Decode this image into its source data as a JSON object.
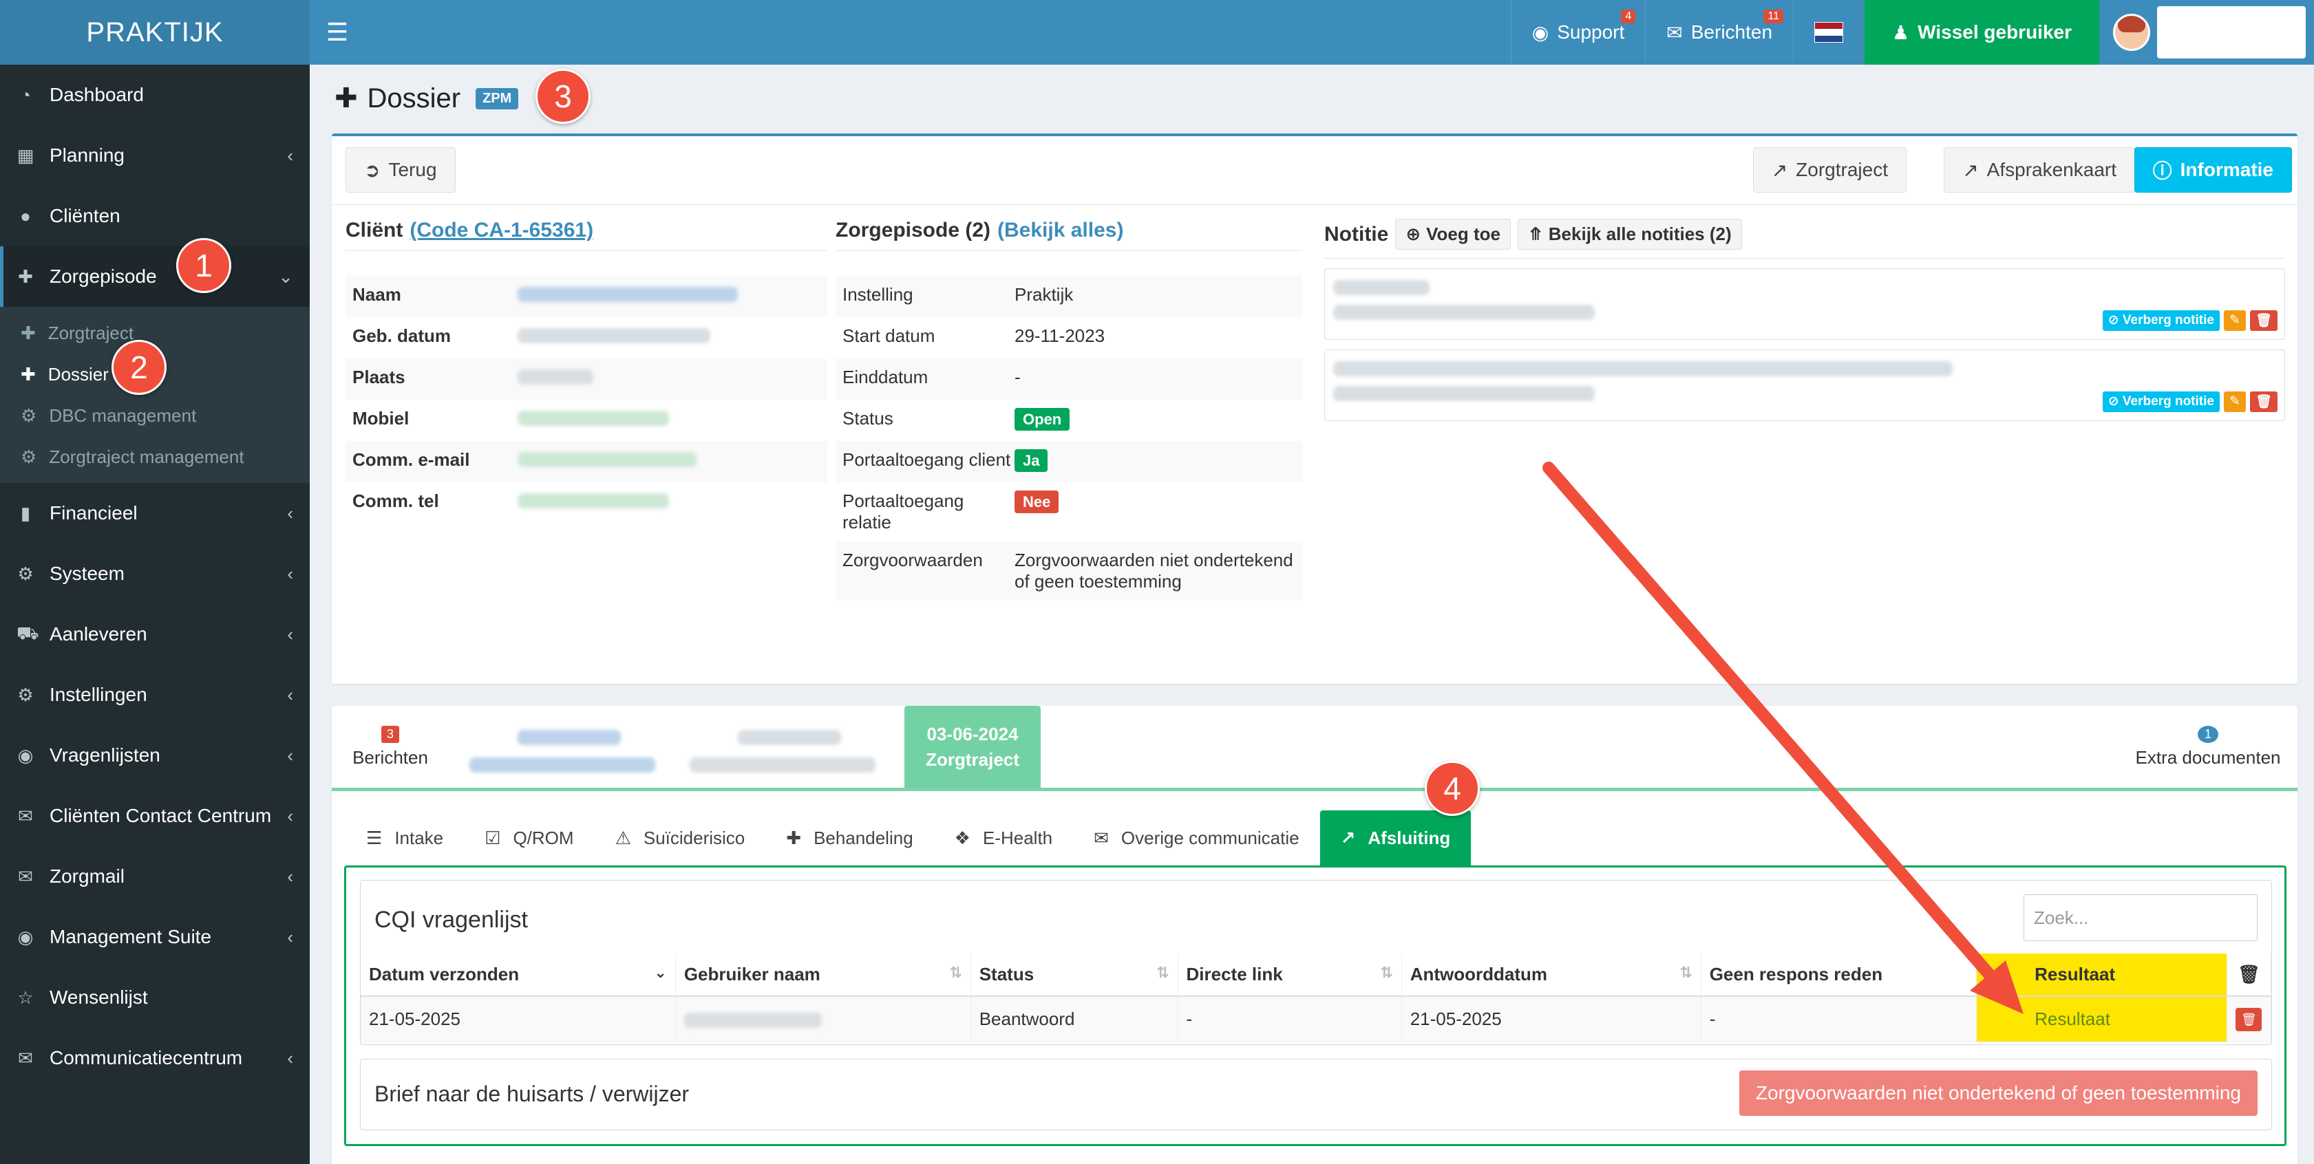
{
  "app": {
    "brand": "PRAKTIJK"
  },
  "topbar": {
    "support_label": "Support",
    "support_count": "4",
    "berichten_label": "Berichten",
    "berichten_count": "11",
    "wissel_label": "Wissel gebruiker"
  },
  "sidebar": {
    "items": [
      {
        "label": "Dashboard"
      },
      {
        "label": "Planning"
      },
      {
        "label": "Cliënten"
      },
      {
        "label": "Zorgepisode"
      },
      {
        "label": "Financieel"
      },
      {
        "label": "Systeem"
      },
      {
        "label": "Aanleveren"
      },
      {
        "label": "Instellingen"
      },
      {
        "label": "Vragenlijsten"
      },
      {
        "label": "Cliënten Contact Centrum"
      },
      {
        "label": "Zorgmail"
      },
      {
        "label": "Management Suite"
      },
      {
        "label": "Wensenlijst"
      },
      {
        "label": "Communicatiecentrum"
      }
    ],
    "sub_items": [
      {
        "label": "Zorgtraject"
      },
      {
        "label": "Dossier"
      },
      {
        "label": "DBC management"
      },
      {
        "label": "Zorgtraject management"
      }
    ]
  },
  "steps": [
    "1",
    "2",
    "3",
    "4"
  ],
  "page": {
    "title": "Dossier",
    "badge": "ZPM"
  },
  "toolbar": {
    "back_label": "Terug",
    "zorgtraject_label": "Zorgtraject",
    "afsprakenkaart_label": "Afsprakenkaart",
    "informatie_label": "Informatie"
  },
  "client": {
    "heading": "Cliënt",
    "code_link": "(Code CA-1-65361)",
    "fields": [
      "Naam",
      "Geb. datum",
      "Plaats",
      "Mobiel",
      "Comm. e-mail",
      "Comm. tel"
    ]
  },
  "episode": {
    "heading": "Zorgepisode (2)",
    "view_all": "(Bekijk alles)",
    "rows": [
      {
        "k": "Instelling",
        "v": "Praktijk"
      },
      {
        "k": "Start datum",
        "v": "29-11-2023"
      },
      {
        "k": "Einddatum",
        "v": "-"
      },
      {
        "k": "Status",
        "badge": "Open"
      },
      {
        "k": "Portaaltoegang client",
        "badge": "Ja"
      },
      {
        "k": "Portaaltoegang relatie",
        "badge": "Nee"
      },
      {
        "k": "Zorgvoorwaarden",
        "v": "Zorgvoorwaarden niet ondertekend of geen toestemming"
      }
    ]
  },
  "notes": {
    "heading": "Notitie",
    "add_label": "Voeg toe",
    "view_all_label": "Bekijk alle notities (2)",
    "hide_label": "Verberg notitie"
  },
  "timeline": {
    "berichten_count": "3",
    "berichten_label": "Berichten",
    "active_date": "03-06-2024",
    "active_label": "Zorgtraject",
    "extra_count": "1",
    "extra_label": "Extra documenten"
  },
  "tabs": [
    {
      "label": "Intake"
    },
    {
      "label": "Q/ROM"
    },
    {
      "label": "Suïciderisico"
    },
    {
      "label": "Behandeling"
    },
    {
      "label": "E-Health"
    },
    {
      "label": "Overige communicatie"
    },
    {
      "label": "Afsluiting"
    }
  ],
  "cqi": {
    "title": "CQI vragenlijst",
    "search_placeholder": "Zoek...",
    "columns": [
      "Datum verzonden",
      "Gebruiker naam",
      "Status",
      "Directe link",
      "Antwoorddatum",
      "Geen respons reden",
      "Resultaat"
    ],
    "row": {
      "datum": "21-05-2025",
      "status": "Beantwoord",
      "link": "-",
      "antwoord": "21-05-2025",
      "reden": "-",
      "resultaat": "Resultaat"
    }
  },
  "brief": {
    "title": "Brief naar de huisarts / verwijzer",
    "button": "Zorgvoorwaarden niet ondertekend of geen toestemming"
  },
  "colors": {
    "primary": "#3c8dbc",
    "success": "#00a65a",
    "danger": "#dd4b39",
    "highlight": "#ffe600",
    "arrow": "#f04e3a"
  }
}
